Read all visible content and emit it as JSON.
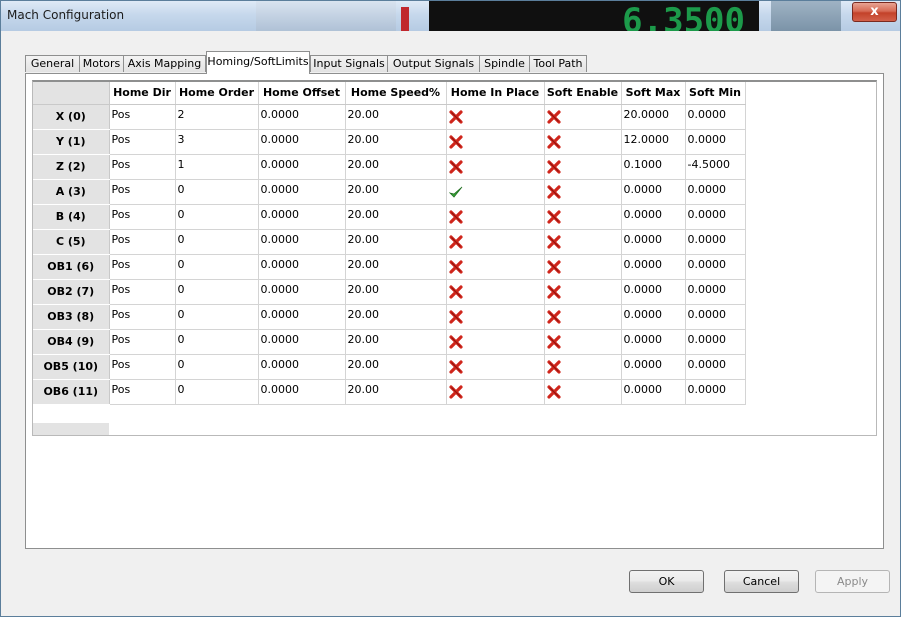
{
  "window": {
    "title": "Mach Configuration",
    "close_label": "x",
    "background_readout": "6.3500"
  },
  "tabs": [
    {
      "label": "General"
    },
    {
      "label": "Motors"
    },
    {
      "label": "Axis Mapping"
    },
    {
      "label": "Homing/SoftLimits",
      "active": true
    },
    {
      "label": "Input Signals"
    },
    {
      "label": "Output Signals"
    },
    {
      "label": "Spindle"
    },
    {
      "label": "Tool Path"
    }
  ],
  "grid": {
    "columns": [
      "Home Dir",
      "Home Order",
      "Home Offset",
      "Home Speed%",
      "Home In Place",
      "Soft Enable",
      "Soft Max",
      "Soft Min"
    ],
    "rows": [
      {
        "axis": "X (0)",
        "home_dir": "Pos",
        "home_order": "2",
        "home_offset": "0.0000",
        "home_speed": "20.00",
        "home_in_place": false,
        "soft_enable": false,
        "soft_max": "20.0000",
        "soft_min": "0.0000"
      },
      {
        "axis": "Y (1)",
        "home_dir": "Pos",
        "home_order": "3",
        "home_offset": "0.0000",
        "home_speed": "20.00",
        "home_in_place": false,
        "soft_enable": false,
        "soft_max": "12.0000",
        "soft_min": "0.0000"
      },
      {
        "axis": "Z (2)",
        "home_dir": "Pos",
        "home_order": "1",
        "home_offset": "0.0000",
        "home_speed": "20.00",
        "home_in_place": false,
        "soft_enable": false,
        "soft_max": "0.1000",
        "soft_min": "-4.5000"
      },
      {
        "axis": "A (3)",
        "home_dir": "Pos",
        "home_order": "0",
        "home_offset": "0.0000",
        "home_speed": "20.00",
        "home_in_place": true,
        "soft_enable": false,
        "soft_max": "0.0000",
        "soft_min": "0.0000"
      },
      {
        "axis": "B (4)",
        "home_dir": "Pos",
        "home_order": "0",
        "home_offset": "0.0000",
        "home_speed": "20.00",
        "home_in_place": false,
        "soft_enable": false,
        "soft_max": "0.0000",
        "soft_min": "0.0000"
      },
      {
        "axis": "C (5)",
        "home_dir": "Pos",
        "home_order": "0",
        "home_offset": "0.0000",
        "home_speed": "20.00",
        "home_in_place": false,
        "soft_enable": false,
        "soft_max": "0.0000",
        "soft_min": "0.0000"
      },
      {
        "axis": "OB1 (6)",
        "home_dir": "Pos",
        "home_order": "0",
        "home_offset": "0.0000",
        "home_speed": "20.00",
        "home_in_place": false,
        "soft_enable": false,
        "soft_max": "0.0000",
        "soft_min": "0.0000"
      },
      {
        "axis": "OB2 (7)",
        "home_dir": "Pos",
        "home_order": "0",
        "home_offset": "0.0000",
        "home_speed": "20.00",
        "home_in_place": false,
        "soft_enable": false,
        "soft_max": "0.0000",
        "soft_min": "0.0000"
      },
      {
        "axis": "OB3 (8)",
        "home_dir": "Pos",
        "home_order": "0",
        "home_offset": "0.0000",
        "home_speed": "20.00",
        "home_in_place": false,
        "soft_enable": false,
        "soft_max": "0.0000",
        "soft_min": "0.0000"
      },
      {
        "axis": "OB4 (9)",
        "home_dir": "Pos",
        "home_order": "0",
        "home_offset": "0.0000",
        "home_speed": "20.00",
        "home_in_place": false,
        "soft_enable": false,
        "soft_max": "0.0000",
        "soft_min": "0.0000"
      },
      {
        "axis": "OB5 (10)",
        "home_dir": "Pos",
        "home_order": "0",
        "home_offset": "0.0000",
        "home_speed": "20.00",
        "home_in_place": false,
        "soft_enable": false,
        "soft_max": "0.0000",
        "soft_min": "0.0000"
      },
      {
        "axis": "OB6 (11)",
        "home_dir": "Pos",
        "home_order": "0",
        "home_offset": "0.0000",
        "home_speed": "20.00",
        "home_in_place": false,
        "soft_enable": false,
        "soft_max": "0.0000",
        "soft_min": "0.0000"
      }
    ]
  },
  "buttons": {
    "ok": "OK",
    "cancel": "Cancel",
    "apply": "Apply"
  },
  "icons": {
    "checked": "green-check-icon",
    "unchecked": "red-x-icon"
  },
  "colors": {
    "check_green": "#3aa83a",
    "x_red": "#d0261c",
    "dro_green": "#1c9a4a"
  }
}
